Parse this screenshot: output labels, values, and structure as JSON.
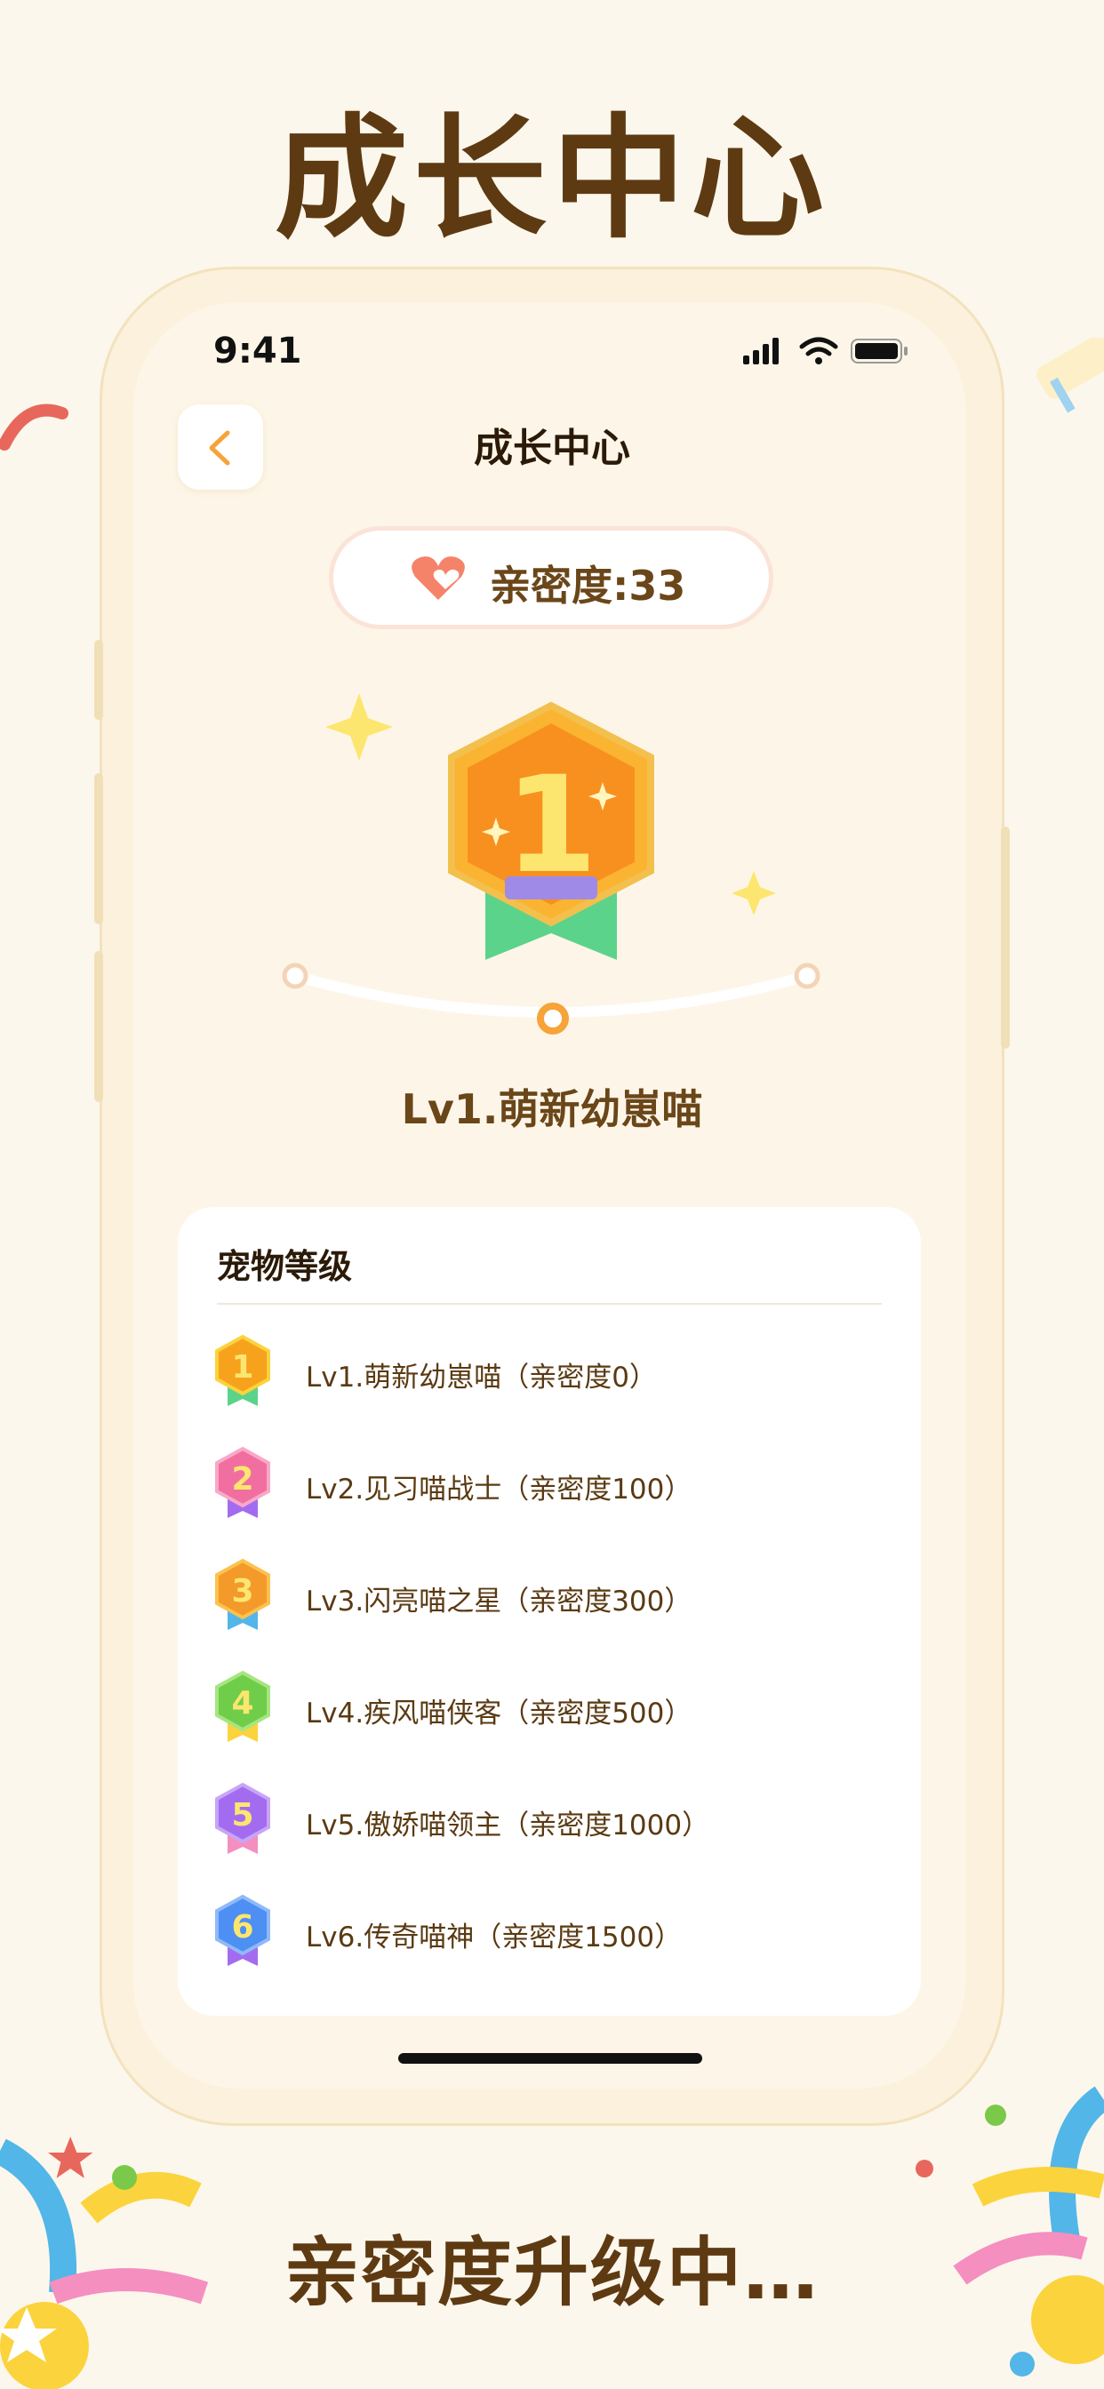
{
  "headline": "成长中心",
  "footer": "亲密度升级中…",
  "status": {
    "time": "9:41"
  },
  "nav": {
    "title": "成长中心"
  },
  "intimacy": {
    "label": "亲密度:33"
  },
  "current_level": {
    "badge_number": "1",
    "title": "Lv1.萌新幼崽喵"
  },
  "levels_card": {
    "title": "宠物等级",
    "items": [
      {
        "num": "1",
        "label": "Lv1.萌新幼崽喵（亲密度0）",
        "color": "#f7a21d"
      },
      {
        "num": "2",
        "label": "Lv2.见习喵战士（亲密度100）",
        "color": "#f06fa0"
      },
      {
        "num": "3",
        "label": "Lv3.闪亮喵之星（亲密度300）",
        "color": "#f39a2a"
      },
      {
        "num": "4",
        "label": "Lv4.疾风喵侠客（亲密度500）",
        "color": "#6fcd4a"
      },
      {
        "num": "5",
        "label": "Lv5.傲娇喵领主（亲密度1000）",
        "color": "#a36cf0"
      },
      {
        "num": "6",
        "label": "Lv6.传奇喵神（亲密度1500）",
        "color": "#4d8ff3"
      }
    ]
  },
  "colors": {
    "accent": "#f6a339",
    "brown": "#5e3a12",
    "background": "#fcf7ec"
  }
}
